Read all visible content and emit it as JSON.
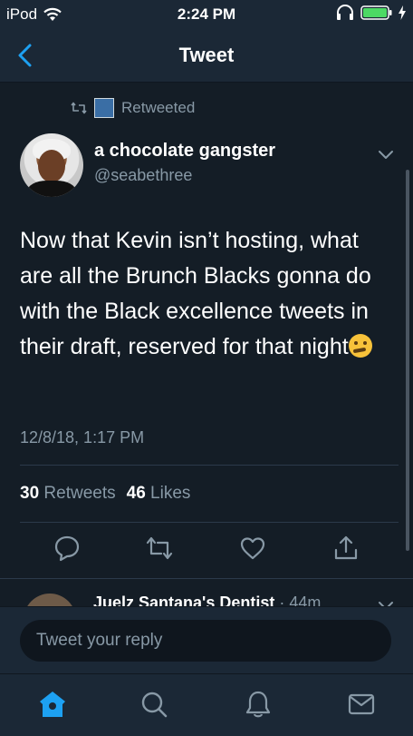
{
  "status_bar": {
    "carrier": "iPod",
    "time": "2:24 PM"
  },
  "nav": {
    "title": "Tweet"
  },
  "retweet": {
    "label": "Retweeted"
  },
  "tweet": {
    "author_name": "a chocolate gangster",
    "author_handle": "@seabethree",
    "text": "Now that Kevin isn’t hosting, what are all the Brunch Blacks gonna do with the Black excellence tweets in their draft, reserved for that night",
    "emoji": "thinking-face",
    "timestamp": "12/8/18, 1:17 PM",
    "retweets_count": "30",
    "retweets_label": "Retweets",
    "likes_count": "46",
    "likes_label": "Likes"
  },
  "next_tweet": {
    "author_name": "Juelz Santana's Dentist",
    "time": "· 44m"
  },
  "reply": {
    "placeholder": "Tweet your reply"
  },
  "colors": {
    "accent": "#1da1f2",
    "background": "#141d26",
    "bar": "#1b2836",
    "muted": "#8899a6",
    "battery": "#4cd964"
  },
  "icons": [
    "wifi-icon",
    "headphones-icon",
    "battery-icon",
    "charging-icon",
    "back-chevron-icon",
    "retweet-icon",
    "chevron-down-icon",
    "reply-icon",
    "heart-icon",
    "share-icon",
    "home-icon",
    "search-icon",
    "notifications-icon",
    "messages-icon"
  ]
}
